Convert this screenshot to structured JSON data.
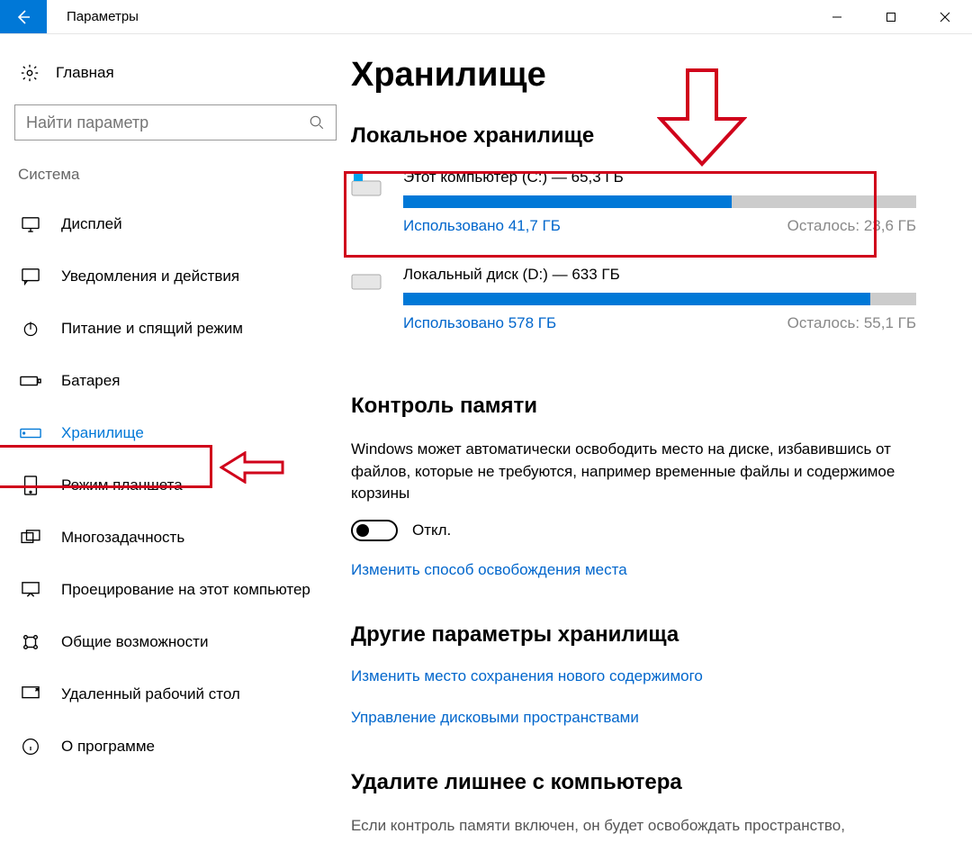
{
  "titlebar": {
    "title": "Параметры"
  },
  "sidebar": {
    "home": "Главная",
    "search_placeholder": "Найти параметр",
    "section": "Система",
    "items": [
      {
        "label": "Дисплей"
      },
      {
        "label": "Уведомления и действия"
      },
      {
        "label": "Питание и спящий режим"
      },
      {
        "label": "Батарея"
      },
      {
        "label": "Хранилище"
      },
      {
        "label": "Режим планшета"
      },
      {
        "label": "Многозадачность"
      },
      {
        "label": "Проецирование на этот компьютер"
      },
      {
        "label": "Общие возможности"
      },
      {
        "label": "Удаленный рабочий стол"
      },
      {
        "label": "О программе"
      }
    ]
  },
  "main": {
    "heading": "Хранилище",
    "local_heading": "Локальное хранилище",
    "drives": [
      {
        "title": "Этот компьютер (C:) — 65,3 ГБ",
        "used_label": "Использовано 41,7 ГБ",
        "remain_label": "Осталось: 23,6 ГБ",
        "fill_percent": 64
      },
      {
        "title": "Локальный диск (D:) — 633 ГБ",
        "used_label": "Использовано 578 ГБ",
        "remain_label": "Осталось: 55,1 ГБ",
        "fill_percent": 91
      }
    ],
    "sense_heading": "Контроль памяти",
    "sense_body": "Windows может автоматически освободить место на диске, избавившись от файлов, которые не требуются, например временные файлы и содержимое корзины",
    "toggle_state": "Откл.",
    "change_free_link": "Изменить способ освобождения места",
    "other_heading": "Другие параметры хранилища",
    "other_link1": "Изменить место сохранения нового содержимого",
    "other_link2": "Управление дисковыми пространствами",
    "cleanup_heading": "Удалите лишнее с компьютера",
    "cleanup_body": "Если контроль памяти включен, он будет освобождать пространство,"
  }
}
